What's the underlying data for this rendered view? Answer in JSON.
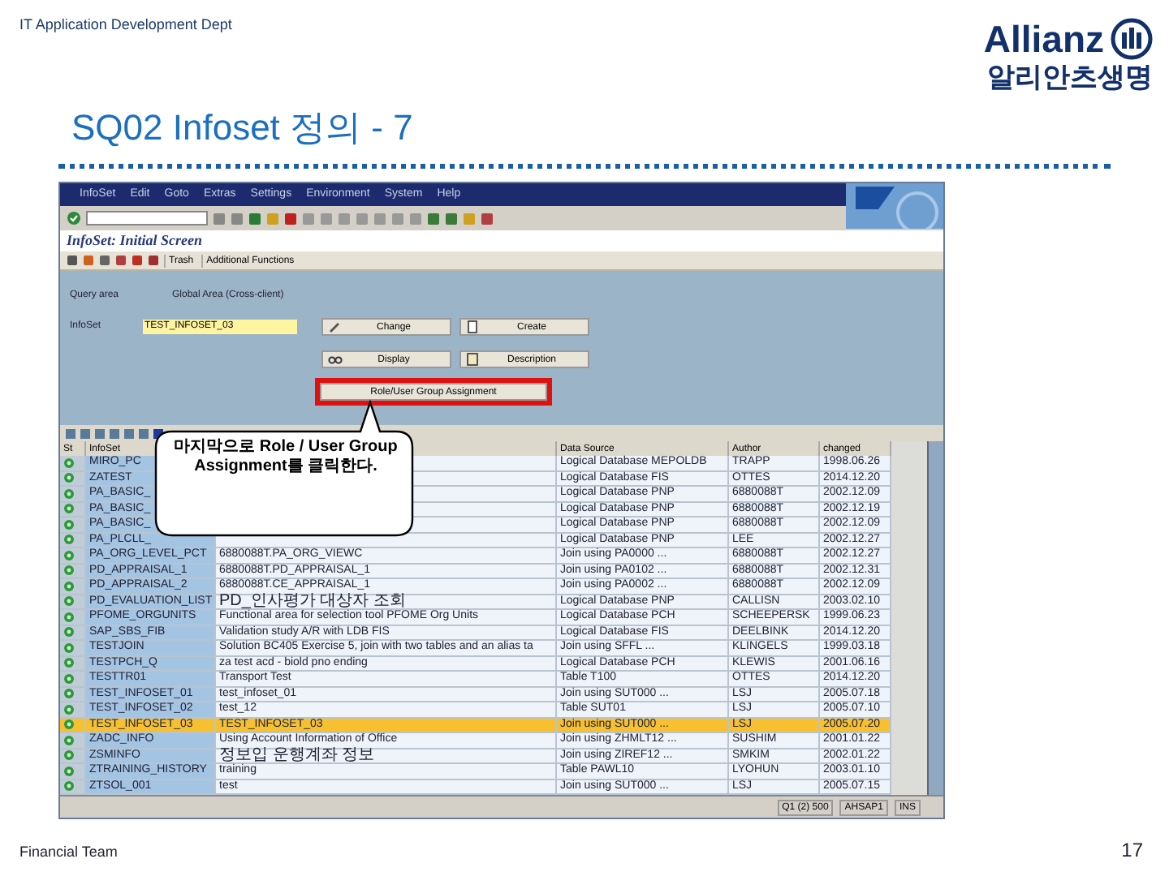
{
  "header": {
    "department": "IT Application Development Dept",
    "logo_text": "Allianz",
    "logo_subtext": "알리안츠생명"
  },
  "slide_title": "SQ02 Infoset 정의 - 7",
  "sap": {
    "menu": [
      "InfoSet",
      "Edit",
      "Goto",
      "Extras",
      "Settings",
      "Environment",
      "System",
      "Help"
    ],
    "screen_title": "InfoSet: Initial Screen",
    "app_toolbar": [
      "Trash",
      "Additional Functions"
    ],
    "query_area": {
      "label": "Query area",
      "value": "Global Area (Cross-client)"
    },
    "infoset_field": {
      "label": "InfoSet",
      "value": "TEST_INFOSET_03"
    },
    "buttons": [
      {
        "label": "Change",
        "kind": "pencil",
        "highlighted": false
      },
      {
        "label": "Create",
        "kind": "page",
        "highlighted": false
      },
      {
        "label": "Display",
        "kind": "glasses",
        "highlighted": false
      },
      {
        "label": "Description",
        "kind": "note",
        "highlighted": false
      },
      {
        "label": "Role/User Group Assignment",
        "kind": "plain",
        "highlighted": true
      }
    ],
    "table": {
      "columns": [
        "St",
        "InfoSet",
        "Data Source",
        "Author",
        "changed"
      ],
      "rows": [
        {
          "infoset": "MIRO_PC",
          "data_source": "Logical Database MEPOLDB",
          "author": "TRAPP",
          "changed": "1998.06.26",
          "selected": false
        },
        {
          "infoset": "ZATEST",
          "data_source": "Logical Database FIS",
          "author": "OTTES",
          "changed": "2014.12.20",
          "selected": false
        },
        {
          "infoset": "PA_BASIC_",
          "data_source": "Logical Database PNP",
          "author": "6880088T",
          "changed": "2002.12.09",
          "selected": false
        },
        {
          "infoset": "PA_BASIC_",
          "data_source": "Logical Database PNP",
          "author": "6880088T",
          "changed": "2002.12.19",
          "selected": false
        },
        {
          "infoset": "PA_BASIC_",
          "data_source": "Logical Database PNP",
          "author": "6880088T",
          "changed": "2002.12.09",
          "selected": false
        },
        {
          "infoset": "PA_PLCLL_",
          "data_source": "Logical Database PNP",
          "author": "LEE",
          "changed": "2002.12.27",
          "selected": false
        },
        {
          "infoset": "PA_ORG_LEVEL_PCT",
          "title": "6880088T.PA_ORG_VIEWC",
          "data_source": "Join using PA0000 ...",
          "author": "6880088T",
          "changed": "2002.12.27",
          "selected": false
        },
        {
          "infoset": "PD_APPRAISAL_1",
          "title": "6880088T.PD_APPRAISAL_1",
          "data_source": "Join using PA0102 ...",
          "author": "6880088T",
          "changed": "2002.12.31",
          "selected": false
        },
        {
          "infoset": "PD_APPRAISAL_2",
          "title": "6880088T.CE_APPRAISAL_1",
          "data_source": "Join using PA0002 ...",
          "author": "6880088T",
          "changed": "2002.12.09",
          "selected": false
        },
        {
          "infoset": "PD_EVALUATION_LIST",
          "title": "PD_인사평가 대상자 조회",
          "data_source": "Logical Database PNP",
          "author": "CALLISN",
          "changed": "2003.02.10",
          "selected": false
        },
        {
          "infoset": "PFOME_ORGUNITS",
          "title": "Functional area for selection tool PFOME Org Units",
          "data_source": "Logical Database PCH",
          "author": "SCHEEPERSK",
          "changed": "1999.06.23",
          "selected": false
        },
        {
          "infoset": "SAP_SBS_FIB",
          "title": "Validation study A/R with LDB FIS",
          "data_source": "Logical Database FIS",
          "author": "DEELBINK",
          "changed": "2014.12.20",
          "selected": false
        },
        {
          "infoset": "TESTJOIN",
          "title": "Solution BC405 Exercise 5, join with two tables and an alias ta",
          "data_source": "Join using SFFL ...",
          "author": "KLINGELS",
          "changed": "1999.03.18",
          "selected": false
        },
        {
          "infoset": "TESTPCH_Q",
          "title": "za test acd - biold pno ending",
          "data_source": "Logical Database PCH",
          "author": "KLEWIS",
          "changed": "2001.06.16",
          "selected": false
        },
        {
          "infoset": "TESTTR01",
          "title": "Transport Test",
          "data_source": "Table T100",
          "author": "OTTES",
          "changed": "2014.12.20",
          "selected": false
        },
        {
          "infoset": "TEST_INFOSET_01",
          "title": "test_infoset_01",
          "data_source": "Join using SUT000 ...",
          "author": "LSJ",
          "changed": "2005.07.18",
          "selected": false
        },
        {
          "infoset": "TEST_INFOSET_02",
          "title": "test_12",
          "data_source": "Table SUT01",
          "author": "LSJ",
          "changed": "2005.07.10",
          "selected": false
        },
        {
          "infoset": "TEST_INFOSET_03",
          "title": "TEST_INFOSET_03",
          "data_source": "Join using SUT000 ...",
          "author": "LSJ",
          "changed": "2005.07.20",
          "selected": true
        },
        {
          "infoset": "ZADC_INFO",
          "title": "Using Account Information of Office",
          "data_source": "Join using ZHMLT12 ...",
          "author": "SUSHIM",
          "changed": "2001.01.22",
          "selected": false
        },
        {
          "infoset": "ZSMINFO",
          "title": "정보입 운행계좌 정보",
          "data_source": "Join using ZIREF12 ...",
          "author": "SMKIM",
          "changed": "2002.01.22",
          "selected": false
        },
        {
          "infoset": "ZTRAINING_HISTORY",
          "title": "training",
          "data_source": "Table PAWL10",
          "author": "LYOHUN",
          "changed": "2003.01.10",
          "selected": false
        },
        {
          "infoset": "ZTSOL_001",
          "title": "test",
          "data_source": "Join using SUT000 ...",
          "author": "LSJ",
          "changed": "2005.07.15",
          "selected": false
        }
      ]
    },
    "status_bar": [
      "Q1 (2) 500",
      "AHSAP1",
      "INS"
    ]
  },
  "callout": "마지막으로 Role / User Group Assignment를 클릭한다.",
  "footer": {
    "team": "Financial Team",
    "page": "17"
  }
}
